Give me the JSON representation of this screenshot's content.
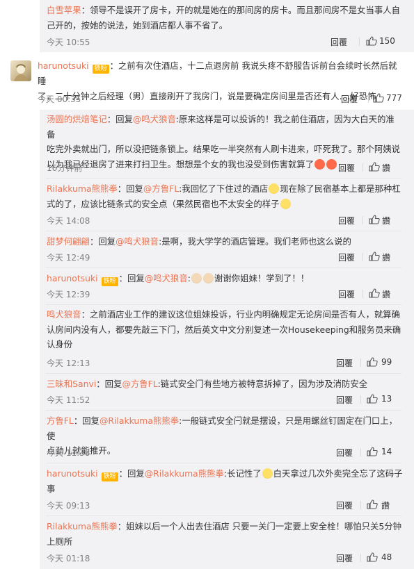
{
  "thumb_icon": "thumbs-up-icon",
  "colors": {
    "username": "#eb7350",
    "badge": "#ffb400",
    "panel_bg": "#f2f2f5",
    "time": "#808080"
  },
  "comments": [
    {
      "user": "白雪苹果",
      "sep": "：",
      "text_lines": [
        "领导不是误开了房卡，开的就是她在的那间房的房卡。而且那间房不是女当事人自",
        "己开的，按她的说法，她到酒店都人事不省了。"
      ],
      "time": "今天 10:55",
      "reply": "回覆",
      "likes": "150"
    },
    {
      "user": "harunotsuki",
      "badge": "铁粉",
      "sep": "：",
      "text_lines": [
        "之前有次住酒店，十二点退房前 我说头疼不舒服告诉前台会续时长然后就睡",
        "了，二十分钟之后经理（男）直接刷开了我房门，说是要确定房间里是否还有人....好恐怖"
      ],
      "time": "今天 00:35",
      "reply": "回覆",
      "likes": "777"
    }
  ],
  "replies": [
    {
      "user": "汤圆的烘焙笔记",
      "pre": "：回复",
      "mention": "@鸣犬狼音",
      "line1": ":原来这样是可以投诉的！我之前住酒店，因为大白天的准备",
      "line2": "吃完外卖就出门，所以没把链条锁上。结果吃一半突然有人刷卡进来，吓死我了。那个阿姨说",
      "line3": "以为我已经退房了进来打扫卫生。想想是个女的我也没受到伤害就算了",
      "time": "16分钟前",
      "reply": "回覆",
      "like_label": "讚"
    },
    {
      "user": "Rilakkuma熊熊拳",
      "pre": "：回复",
      "mention": "@方鲁FL",
      "line1a": ":我回忆了下住过的酒店",
      "line1b": "现在除了民宿基本上都是那种杠",
      "line2": "式的了，应该比链条式的安全点（果然民宿也不太安全的样子",
      "time": "今天 14:08",
      "reply": "回覆",
      "like_label": "讚"
    },
    {
      "user": "甜梦何翩翩",
      "pre": "：回复",
      "mention": "@鸣犬狼音",
      "line1": ":是啊，我大学学的酒店管理。我们老师也这么说的",
      "time": "今天 12:49",
      "reply": "回覆",
      "like_label": "讚"
    },
    {
      "user": "harunotsuki",
      "badge": "铁粉",
      "pre": "：回复",
      "mention": "@鸣犬狼音",
      "line1": ":",
      "line1b": "谢谢你姐妹！学到了！！",
      "time": "今天 12:39",
      "reply": "回覆",
      "like_label": "讚"
    },
    {
      "user": "鸣犬狼音",
      "sep": "：",
      "line1": "之前酒店业工作的建议这位姐妹投诉，行业内明确规定无论房间是否有人，就算确",
      "line2": "认房间内没有人，都要先敲三下门，然后英文中文分别复述一次Housekeeping和服务员来确",
      "line3": "认身份",
      "time": "今天 12:13",
      "reply": "回覆",
      "likes": "99"
    },
    {
      "user": "三昧和Sanvi",
      "pre": "：回复",
      "mention": "@方鲁FL",
      "line1": ":链式安全门有些地方被特意拆掉了，因为涉及消防安全",
      "time": "今天 11:52",
      "reply": "回覆",
      "likes": "13"
    },
    {
      "user": "方鲁FL",
      "pre": "：回复",
      "mention": "@Rilakkuma熊熊拳",
      "line1": ":一般链式安全闩就是摆设，只是用螺丝钉固定在门口上，使",
      "line2": "点劲儿就能推开。",
      "time": "今天 11:38",
      "reply": "回覆",
      "likes": "14"
    },
    {
      "user": "harunotsuki",
      "badge": "铁粉",
      "pre": "：回复",
      "mention": "@Rilakkuma熊熊拳",
      "line1a": ":长记性了",
      "line1b": "白天拿过几次外卖完全忘了这码子",
      "line2": "事",
      "time": "今天 09:13",
      "reply": "回覆",
      "like_label": "讚"
    },
    {
      "user": "Rilakkuma熊熊拳",
      "sep": "：",
      "line1": "姐妹以后一个人出去住酒店 只要一关门一定要上安全栓！哪怕只关5分钟",
      "line2": "上厕所",
      "time": "今天 01:18",
      "reply": "回覆",
      "likes": "48"
    }
  ]
}
